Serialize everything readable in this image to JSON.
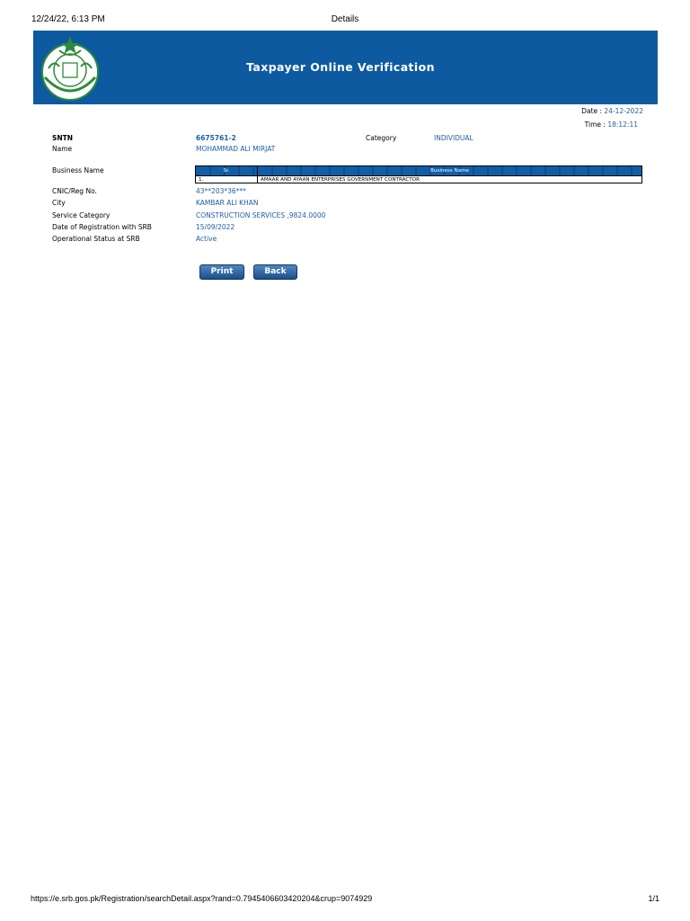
{
  "print_header": {
    "datetime": "12/24/22, 6:13 PM",
    "title": "Details"
  },
  "banner": {
    "title": "Taxpayer Online Verification",
    "logo_icon": "srb-emblem-icon",
    "color": "#0d5aa1"
  },
  "meta": {
    "date_label": "Date : ",
    "date_value": "24-12-2022",
    "time_label": "Time : ",
    "time_value": "18:12:11"
  },
  "fields": {
    "sntn": {
      "label": "SNTN",
      "value": "6675761-2"
    },
    "category": {
      "label": "Category",
      "value": "INDIVIDUAL"
    },
    "name": {
      "label": "Name",
      "value": "MOHAMMAD ALI MIRJAT"
    },
    "business_name": {
      "label": "Business Name"
    },
    "cnic": {
      "label": "CNIC/Reg No.",
      "value": "43**203*36***"
    },
    "city": {
      "label": "City",
      "value": "KAMBAR ALI KHAN"
    },
    "service_category": {
      "label": "Service Category",
      "value": "CONSTRUCTION SERVICES ,9824.0000"
    },
    "registration_date": {
      "label": "Date of Registration with SRB",
      "value": "15/09/2022"
    },
    "operational_status": {
      "label": "Operational Status at SRB",
      "value": "Active"
    }
  },
  "business_table": {
    "headers": [
      "Sr.",
      "Business Name"
    ],
    "rows": [
      [
        "1.",
        "AMAAR AND AYAAN ENTERPRISES GOVERNMENT CONTRACTOR"
      ]
    ]
  },
  "buttons": {
    "print": "Print",
    "back": "Back"
  },
  "print_footer": {
    "url": "https://e.srb.gos.pk/Registration/searchDetail.aspx?rand=0.7945406603420204&crup=9074929",
    "page": "1/1"
  },
  "colors": {
    "accent": "#1f5fa6",
    "header_bg": "#0f5ea8"
  }
}
